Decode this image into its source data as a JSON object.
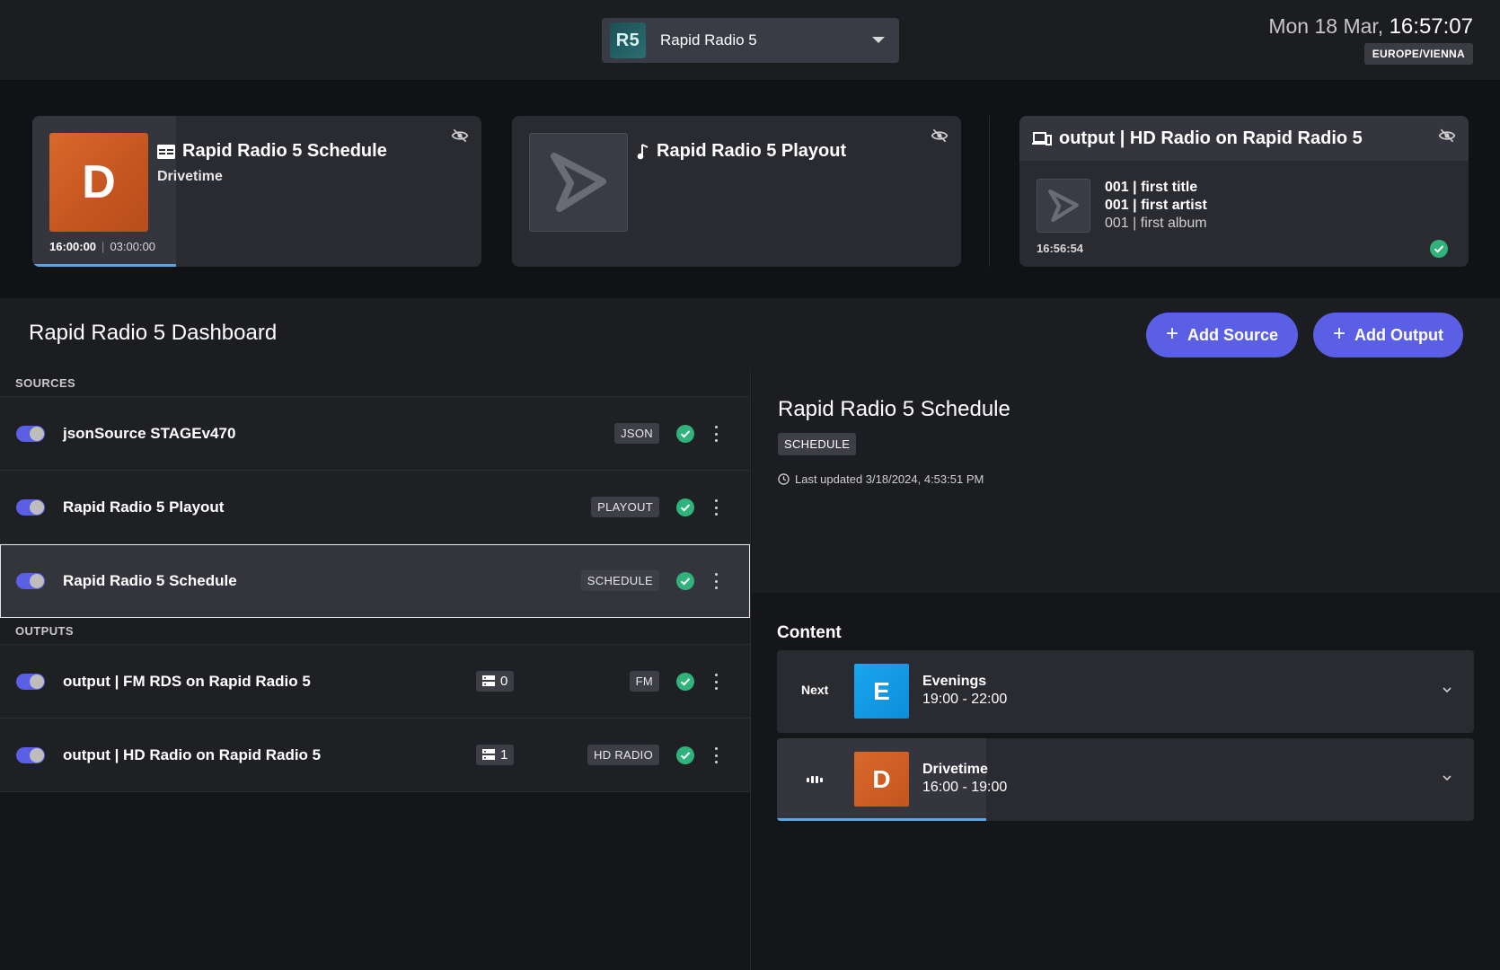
{
  "topbar": {
    "station_logo": "R5",
    "station_name": "Rapid Radio 5",
    "clock_date": "Mon 18 Mar,",
    "clock_time": "16:57:07",
    "timezone": "EUROPE/VIENNA"
  },
  "now_playing": {
    "schedule": {
      "title": "Rapid Radio 5 Schedule",
      "subtitle": "Drivetime",
      "thumb_letter": "D",
      "start": "16:00:00",
      "duration": "03:00:00",
      "progress": 0.32
    },
    "playout": {
      "title": "Rapid Radio 5 Playout"
    },
    "output": {
      "title": "output | HD Radio on Rapid Radio 5",
      "line1": "001 | first title",
      "line2": "001 | first artist",
      "line3": "001 | first album",
      "time": "16:56:54"
    }
  },
  "dashboard": {
    "title": "Rapid Radio 5 Dashboard",
    "add_source": "Add Source",
    "add_output": "Add Output"
  },
  "sources": {
    "label": "SOURCES",
    "items": [
      {
        "name": "jsonSource STAGEv470",
        "type": "JSON"
      },
      {
        "name": "Rapid Radio 5 Playout",
        "type": "PLAYOUT"
      },
      {
        "name": "Rapid Radio 5 Schedule",
        "type": "SCHEDULE"
      }
    ]
  },
  "outputs": {
    "label": "OUTPUTS",
    "items": [
      {
        "name": "output | FM RDS on Rapid Radio 5",
        "count": "0",
        "type": "FM"
      },
      {
        "name": "output | HD Radio on Rapid Radio 5",
        "count": "1",
        "type": "HD RADIO"
      }
    ]
  },
  "detail": {
    "title": "Rapid Radio 5 Schedule",
    "type": "SCHEDULE",
    "updated": "Last updated 3/18/2024, 4:53:51 PM",
    "content_label": "Content",
    "items": [
      {
        "lead": "Next",
        "letter": "E",
        "name": "Evenings",
        "time": "19:00 - 22:00"
      },
      {
        "letter": "D",
        "name": "Drivetime",
        "time": "16:00 - 19:00",
        "progress": 0.3
      }
    ]
  },
  "colors": {
    "accent": "#5b5fe6",
    "success": "#2fb37a",
    "progress": "#5aa7e8"
  }
}
